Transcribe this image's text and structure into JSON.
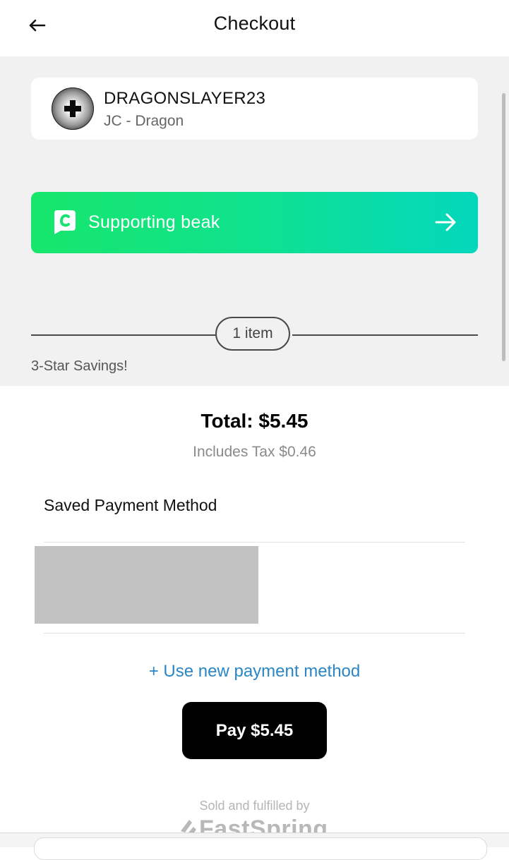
{
  "header": {
    "back_icon": "arrow-left-icon",
    "title": "Checkout"
  },
  "creator": {
    "name": "DRAGONSLAYER23",
    "subtitle": "JC - Dragon",
    "avatar_icon": "cross-icon"
  },
  "support": {
    "label": "Supporting beak",
    "logo_icon": "creator-code-logo-icon",
    "arrow_icon": "arrow-right-icon",
    "gradient_start": "#17e66b",
    "gradient_end": "#03d7bd"
  },
  "cart": {
    "item_count": "1 item",
    "savings_label": "3-Star Savings!"
  },
  "summary": {
    "total": "Total: $5.45",
    "tax": "Includes Tax $0.46"
  },
  "payment": {
    "saved_label": "Saved Payment Method",
    "new_method_link": "+ Use new payment method",
    "link_color": "#2a86c5",
    "pay_button": "Pay $5.45"
  },
  "footer": {
    "sold_by": "Sold and fulfilled by",
    "vendor": "FastSpring"
  }
}
